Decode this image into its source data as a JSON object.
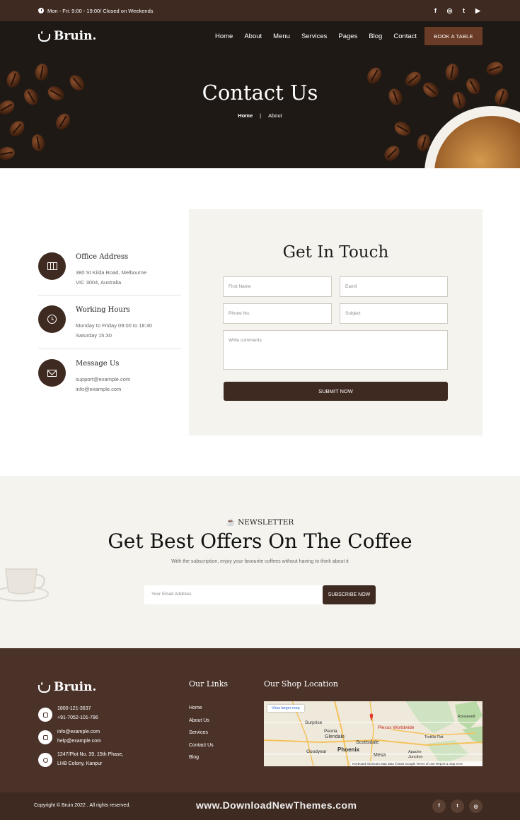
{
  "topbar": {
    "hours": "Mon - Fri: 9:00 - 19:00/ Closed on Weekends",
    "social": [
      "f",
      "◎",
      "t",
      "▶"
    ]
  },
  "brand": {
    "name": "Bruin."
  },
  "nav": {
    "items": [
      "Home",
      "About",
      "Menu",
      "Services",
      "Pages",
      "Blog",
      "Contact"
    ],
    "cta": "BOOK A TABLE"
  },
  "hero": {
    "title": "Contact Us",
    "breadcrumb": {
      "home": "Home",
      "separator": "|",
      "current": "About"
    }
  },
  "contact_info": [
    {
      "title": "Office Address",
      "icon": "map-icon",
      "lines": [
        "380 St Kilda Road, Melbourne",
        "VIC 3004, Australia"
      ]
    },
    {
      "title": "Working Hours",
      "icon": "clock-icon",
      "lines": [
        "Monday to Friday 09:00 to 18:30",
        "Saturday 15:30"
      ]
    },
    {
      "title": "Message Us",
      "icon": "envelope-icon",
      "lines": [
        "support@example.com",
        "info@example.com"
      ]
    }
  ],
  "form": {
    "title": "Get In Touch",
    "first_name": "First Name",
    "email": "Eamil",
    "phone": "Phone No.",
    "subject": "Subject",
    "comments": "Write comments",
    "submit": "SUBMIT NOW"
  },
  "newsletter": {
    "tag": "NEWSLETTER",
    "title": "Get Best Offers On The Coffee",
    "subtitle": "With the subscription, enjoy your favourite coffees without having to think about it",
    "placeholder": "Your Email Address",
    "button": "SUBSCRIBE NOW"
  },
  "footer": {
    "phones": [
      "1800-121-3637",
      "+91-7052-101-786"
    ],
    "emails": [
      "info@example.com",
      "help@example.com"
    ],
    "address": [
      "1247/Plot No. 39, 15th Phase,",
      "LHB Colony, Kanpur"
    ],
    "links_title": "Our Links",
    "links": [
      "Home",
      "About Us",
      "Services",
      "Contact Us",
      "Blog"
    ],
    "location_title": "Our Shop Location",
    "map": {
      "larger": "View larger map",
      "labels": [
        "Surprise",
        "Peoria",
        "Glendale",
        "Phoenix",
        "Scottsdale",
        "Mesa",
        "Goodyear",
        "Apache Junction",
        "Tortilla Flat",
        "Roosevelt",
        "Plexus Worldwide"
      ],
      "attribution": "Keyboard shortcuts   Map data ©2022 Google   Terms of Use   Report a map error"
    },
    "copyright": "Copyright © Bruin 2022 . All rights reserved.",
    "watermark": "www.DownloadNewThemes.com",
    "social": [
      "f",
      "t",
      "◎"
    ]
  },
  "colors": {
    "dark_brown": "#3e2a21",
    "footer_brown": "#4b3229",
    "cream": "#f4f3ee",
    "cta_brown": "#6a3b26"
  }
}
